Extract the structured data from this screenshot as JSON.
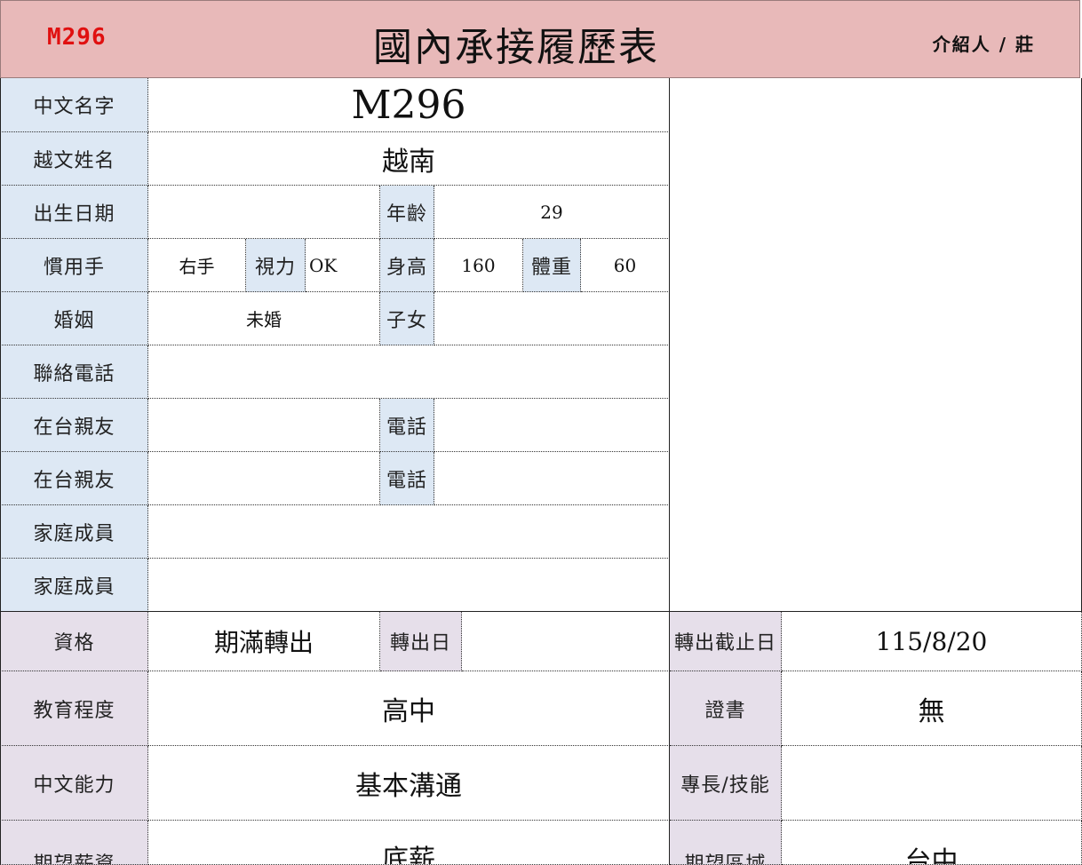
{
  "header": {
    "code": "M296",
    "title": "國內承接履歷表",
    "referrer": "介紹人 / 莊"
  },
  "labels": {
    "chinese_name": "中文名字",
    "viet_name": "越文姓名",
    "birth_date": "出生日期",
    "age": "年齡",
    "handedness": "慣用手",
    "eyesight": "視力",
    "height": "身高",
    "weight": "體重",
    "marriage": "婚姻",
    "children": "子女",
    "contact_phone": "聯絡電話",
    "relatives_1": "在台親友",
    "phone_1": "電話",
    "relatives_2": "在台親友",
    "phone_2": "電話",
    "family_1": "家庭成員",
    "family_2": "家庭成員",
    "qualification": "資格",
    "transfer_date": "轉出日",
    "transfer_deadline": "轉出截止日",
    "education": "教育程度",
    "certificate": "證書",
    "chinese_ability": "中文能力",
    "skills": "專長/技能",
    "expected_salary": "期望薪資",
    "expected_area": "期望區域"
  },
  "values": {
    "chinese_name": "M296",
    "viet_name": "越南",
    "birth_date": "",
    "age": "29",
    "handedness": "右手",
    "eyesight": "OK",
    "height": "160",
    "weight": "60",
    "marriage": "未婚",
    "children": "",
    "contact_phone": "",
    "relatives_1": "",
    "phone_1": "",
    "relatives_2": "",
    "phone_2": "",
    "family_1": "",
    "family_2": "",
    "qualification": "期滿轉出",
    "transfer_date": "",
    "transfer_deadline": "115/8/20",
    "education": "高中",
    "certificate": "無",
    "chinese_ability": "基本溝通",
    "skills": "",
    "expected_salary": "底薪",
    "expected_area": "台中"
  }
}
